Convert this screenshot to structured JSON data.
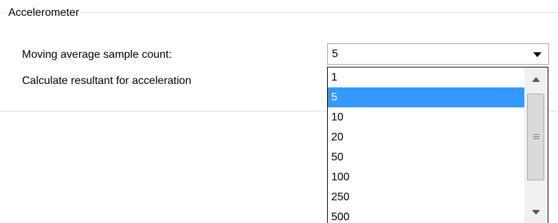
{
  "group": {
    "title": "Accelerometer"
  },
  "settings": {
    "moving_average_label": "Moving average sample count:",
    "resultant_label": "Calculate resultant for acceleration"
  },
  "combo": {
    "selected_value": "5",
    "options": [
      "1",
      "5",
      "10",
      "20",
      "50",
      "100",
      "250",
      "500"
    ],
    "highlighted_index": 1
  },
  "icons": {
    "combo_arrow": "chevron-down-icon",
    "scroll_up": "scroll-up-arrow-icon",
    "scroll_down": "scroll-down-arrow-icon",
    "thumb_grip": "grip-icon"
  },
  "colors": {
    "selection": "#3399ff",
    "group_border": "#dde3ea"
  }
}
